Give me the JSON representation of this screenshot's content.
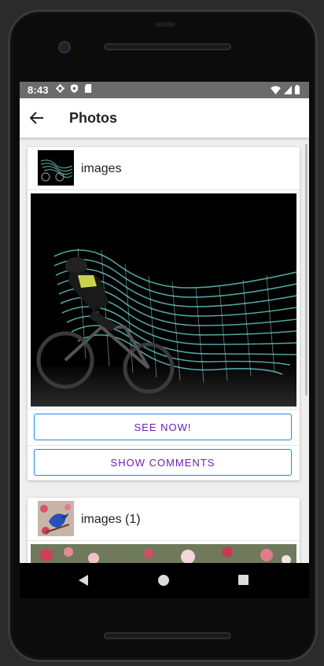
{
  "statusbar": {
    "time": "8:43"
  },
  "appbar": {
    "title": "Photos"
  },
  "posts": [
    {
      "title": "images",
      "see_now_label": "SEE NOW!",
      "comments_label": "SHOW COMMENTS"
    },
    {
      "title": "images (1)"
    }
  ],
  "colors": {
    "button_border": "#1e88e5",
    "button_text": "#6a1fb0",
    "statusbar": "#6b6b6b"
  }
}
